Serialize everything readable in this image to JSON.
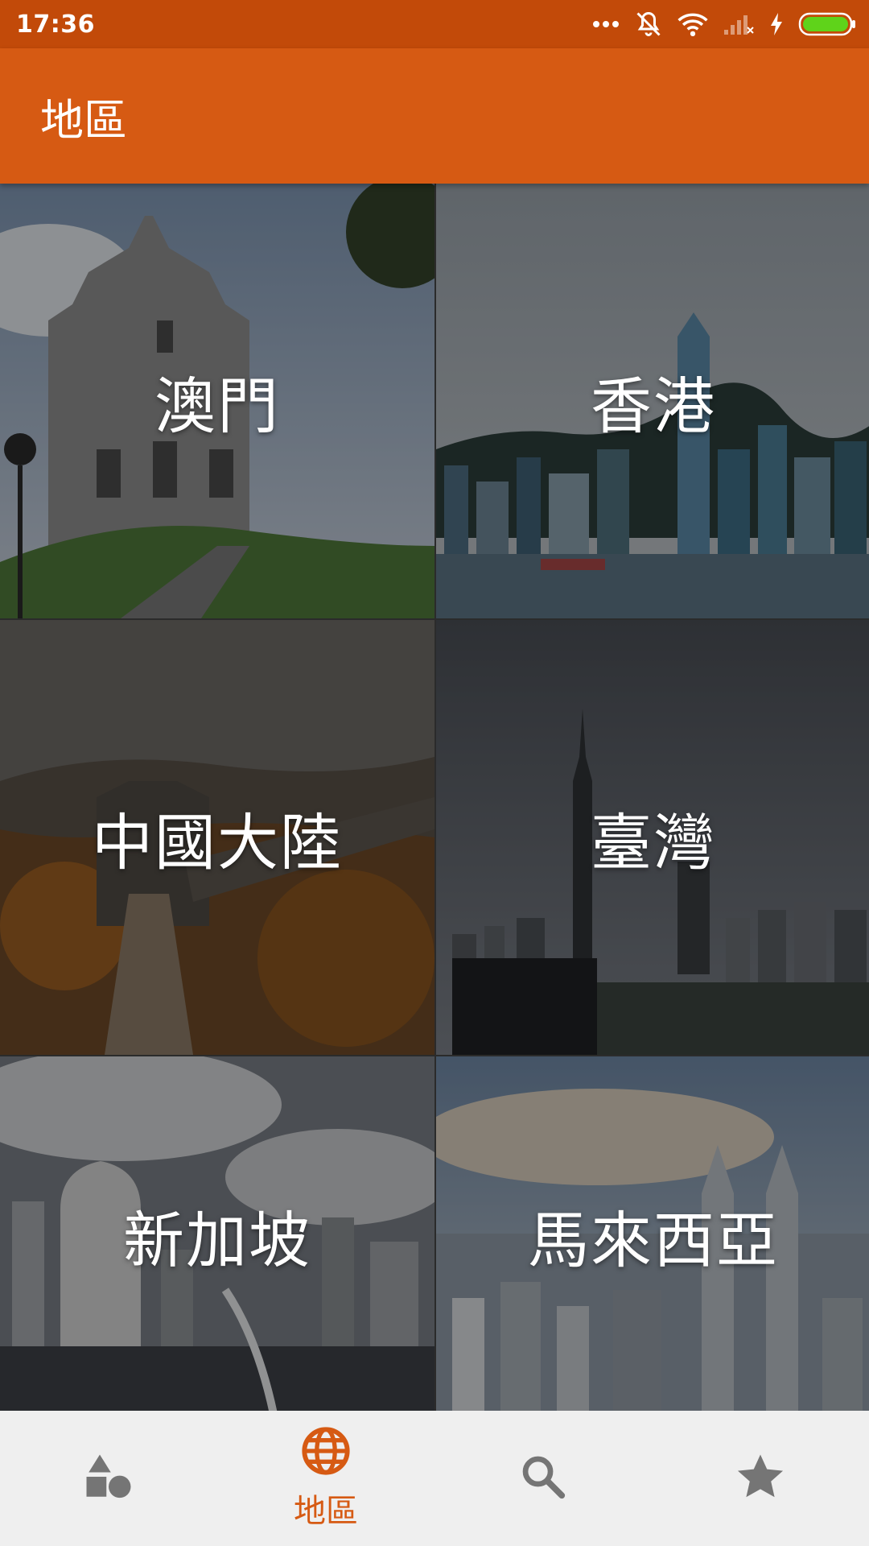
{
  "status_bar": {
    "time": "17:36"
  },
  "app_bar": {
    "title": "地區"
  },
  "regions": [
    {
      "label": "澳門"
    },
    {
      "label": "香港"
    },
    {
      "label": "中國大陸"
    },
    {
      "label": "臺灣"
    },
    {
      "label": "新加坡"
    },
    {
      "label": "馬來西亞"
    }
  ],
  "bottom_nav": {
    "items": [
      {
        "icon": "shapes-icon",
        "label": "",
        "active": false
      },
      {
        "icon": "globe-icon",
        "label": "地區",
        "active": true
      },
      {
        "icon": "search-icon",
        "label": "",
        "active": false
      },
      {
        "icon": "star-icon",
        "label": "",
        "active": false
      }
    ]
  },
  "colors": {
    "status_bar": "#c24a09",
    "app_bar": "#d65a13",
    "accent": "#d65a13",
    "inactive_icon": "#757575"
  }
}
